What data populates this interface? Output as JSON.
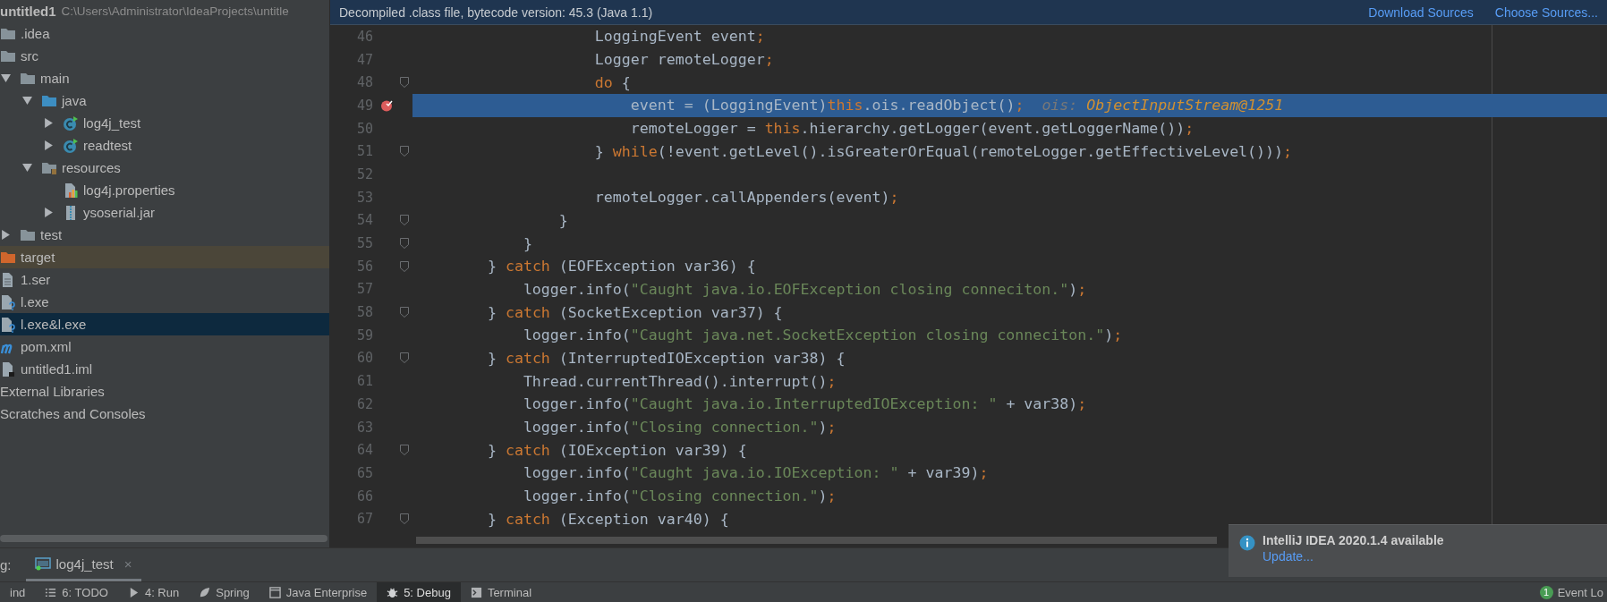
{
  "project_tree": [
    {
      "label": "untitled1",
      "kind": "project",
      "path": "C:\\Users\\Administrator\\IdeaProjects\\untitle",
      "selected": false,
      "children": [
        {
          "label": ".idea",
          "kind": "folder",
          "selected": false
        },
        {
          "label": "src",
          "kind": "folder",
          "selected": false,
          "children": [
            {
              "label": "main",
              "kind": "folder",
              "expanded": true,
              "selected": false,
              "children": [
                {
                  "label": "java",
                  "kind": "source-folder",
                  "expanded": true,
                  "selected": false,
                  "children": [
                    {
                      "label": "log4j_test",
                      "kind": "class",
                      "expanded": false,
                      "selected": false
                    },
                    {
                      "label": "readtest",
                      "kind": "class",
                      "expanded": false,
                      "selected": false
                    }
                  ]
                },
                {
                  "label": "resources",
                  "kind": "resources-folder",
                  "expanded": true,
                  "selected": false,
                  "children": [
                    {
                      "label": "log4j.properties",
                      "kind": "properties",
                      "selected": false
                    },
                    {
                      "label": "ysoserial.jar",
                      "kind": "jar",
                      "expanded": false,
                      "selected": false
                    }
                  ]
                }
              ]
            },
            {
              "label": "test",
              "kind": "folder",
              "expanded": false,
              "selected": false
            }
          ]
        },
        {
          "label": "target",
          "kind": "excluded-folder",
          "selected": false
        },
        {
          "label": "1.ser",
          "kind": "file",
          "selected": false
        },
        {
          "label": "l.exe",
          "kind": "unknown-file",
          "selected": false
        },
        {
          "label": "l.exe&l.exe",
          "kind": "unknown-file",
          "selected": true
        },
        {
          "label": "pom.xml",
          "kind": "maven",
          "selected": false
        },
        {
          "label": "untitled1.iml",
          "kind": "iml",
          "selected": false
        }
      ]
    },
    {
      "label": "External Libraries",
      "kind": "libraries",
      "selected": false
    },
    {
      "label": "Scratches and Consoles",
      "kind": "scratches",
      "selected": false
    }
  ],
  "editor": {
    "banner": "Decompiled .class file, bytecode version: 45.3 (Java 1.1)",
    "banner_links": [
      "Download Sources",
      "Choose Sources..."
    ],
    "lines": [
      {
        "number": "46",
        "tokens": [
          {
            "text": "                    LoggingEvent event",
            "kind": "plain"
          },
          {
            "text": ";",
            "kind": "keyword"
          }
        ]
      },
      {
        "number": "47",
        "tokens": [
          {
            "text": "                    Logger remoteLogger",
            "kind": "plain"
          },
          {
            "text": ";",
            "kind": "keyword"
          }
        ]
      },
      {
        "number": "48",
        "fold": true,
        "tokens": [
          {
            "text": "                    do",
            "kind": "keyword"
          },
          {
            "text": " {",
            "kind": "plain"
          }
        ]
      },
      {
        "number": "49",
        "breakpoint": true,
        "current": true,
        "tokens": [
          {
            "text": "                        event = (LoggingEvent)",
            "kind": "plain"
          },
          {
            "text": "this",
            "kind": "keyword"
          },
          {
            "text": ".ois.readObject()",
            "kind": "plain"
          },
          {
            "text": ";",
            "kind": "keyword"
          }
        ],
        "hint": {
          "name": "ois:",
          "value": "ObjectInputStream@1251"
        }
      },
      {
        "number": "50",
        "tokens": [
          {
            "text": "                        remoteLogger = ",
            "kind": "plain"
          },
          {
            "text": "this",
            "kind": "keyword"
          },
          {
            "text": ".hierarchy.getLogger(event.getLoggerName())",
            "kind": "plain"
          },
          {
            "text": ";",
            "kind": "keyword"
          }
        ]
      },
      {
        "number": "51",
        "fold": true,
        "tokens": [
          {
            "text": "                    } ",
            "kind": "plain"
          },
          {
            "text": "while",
            "kind": "keyword"
          },
          {
            "text": "(!event.getLevel().isGreaterOrEqual(remoteLogger.getEffectiveLevel()))",
            "kind": "plain"
          },
          {
            "text": ";",
            "kind": "keyword"
          }
        ]
      },
      {
        "number": "52"
      },
      {
        "number": "53",
        "tokens": [
          {
            "text": "                    remoteLogger.callAppenders(event)",
            "kind": "plain"
          },
          {
            "text": ";",
            "kind": "keyword"
          }
        ]
      },
      {
        "number": "54",
        "fold": true,
        "tokens": [
          {
            "text": "                }",
            "kind": "plain"
          }
        ]
      },
      {
        "number": "55",
        "fold": true,
        "tokens": [
          {
            "text": "            }",
            "kind": "plain"
          }
        ]
      },
      {
        "number": "56",
        "fold": true,
        "tokens": [
          {
            "text": "        } ",
            "kind": "plain"
          },
          {
            "text": "catch",
            "kind": "keyword"
          },
          {
            "text": " (EOFException var36) {",
            "kind": "plain"
          }
        ]
      },
      {
        "number": "57",
        "tokens": [
          {
            "text": "            logger.info(",
            "kind": "plain"
          },
          {
            "text": "\"Caught java.io.EOFException closing conneciton.\"",
            "kind": "string"
          },
          {
            "text": ")",
            "kind": "plain"
          },
          {
            "text": ";",
            "kind": "keyword"
          }
        ]
      },
      {
        "number": "58",
        "fold": true,
        "tokens": [
          {
            "text": "        } ",
            "kind": "plain"
          },
          {
            "text": "catch",
            "kind": "keyword"
          },
          {
            "text": " (SocketException var37) {",
            "kind": "plain"
          }
        ]
      },
      {
        "number": "59",
        "tokens": [
          {
            "text": "            logger.info(",
            "kind": "plain"
          },
          {
            "text": "\"Caught java.net.SocketException closing conneciton.\"",
            "kind": "string"
          },
          {
            "text": ")",
            "kind": "plain"
          },
          {
            "text": ";",
            "kind": "keyword"
          }
        ]
      },
      {
        "number": "60",
        "fold": true,
        "tokens": [
          {
            "text": "        } ",
            "kind": "plain"
          },
          {
            "text": "catch",
            "kind": "keyword"
          },
          {
            "text": " (InterruptedIOException var38) {",
            "kind": "plain"
          }
        ]
      },
      {
        "number": "61",
        "tokens": [
          {
            "text": "            Thread.currentThread().interrupt()",
            "kind": "plain"
          },
          {
            "text": ";",
            "kind": "keyword"
          }
        ]
      },
      {
        "number": "62",
        "tokens": [
          {
            "text": "            logger.info(",
            "kind": "plain"
          },
          {
            "text": "\"Caught java.io.InterruptedIOException: \"",
            "kind": "string"
          },
          {
            "text": " + var38)",
            "kind": "plain"
          },
          {
            "text": ";",
            "kind": "keyword"
          }
        ]
      },
      {
        "number": "63",
        "tokens": [
          {
            "text": "            logger.info(",
            "kind": "plain"
          },
          {
            "text": "\"Closing connection.\"",
            "kind": "string"
          },
          {
            "text": ")",
            "kind": "plain"
          },
          {
            "text": ";",
            "kind": "keyword"
          }
        ]
      },
      {
        "number": "64",
        "fold": true,
        "tokens": [
          {
            "text": "        } ",
            "kind": "plain"
          },
          {
            "text": "catch",
            "kind": "keyword"
          },
          {
            "text": " (IOException var39) {",
            "kind": "plain"
          }
        ]
      },
      {
        "number": "65",
        "tokens": [
          {
            "text": "            logger.info(",
            "kind": "plain"
          },
          {
            "text": "\"Caught java.io.IOException: \"",
            "kind": "string"
          },
          {
            "text": " + var39)",
            "kind": "plain"
          },
          {
            "text": ";",
            "kind": "keyword"
          }
        ]
      },
      {
        "number": "66",
        "tokens": [
          {
            "text": "            logger.info(",
            "kind": "plain"
          },
          {
            "text": "\"Closing connection.\"",
            "kind": "string"
          },
          {
            "text": ")",
            "kind": "plain"
          },
          {
            "text": ";",
            "kind": "keyword"
          }
        ]
      },
      {
        "number": "67",
        "fold": true,
        "tokens": [
          {
            "text": "        } ",
            "kind": "plain"
          },
          {
            "text": "catch",
            "kind": "keyword"
          },
          {
            "text": " (Exception var40) {",
            "kind": "plain"
          }
        ]
      }
    ]
  },
  "debug_panel": {
    "label": "g:",
    "tabs": [
      {
        "label": "log4j_test",
        "close": "×",
        "selected": true
      }
    ]
  },
  "tool_buttons": [
    {
      "label": "ind",
      "kind": "find",
      "selected": false
    },
    {
      "label": "6: TODO",
      "kind": "todo",
      "selected": false
    },
    {
      "label": "4: Run",
      "kind": "run",
      "selected": false
    },
    {
      "label": "Spring",
      "kind": "spring",
      "selected": false
    },
    {
      "label": "Java Enterprise",
      "kind": "enterprise",
      "selected": false
    },
    {
      "label": "5: Debug",
      "kind": "debug",
      "selected": true
    },
    {
      "label": "Terminal",
      "kind": "terminal",
      "selected": false
    }
  ],
  "event_log": {
    "badge": "1",
    "label": "Event Lo"
  },
  "notification": {
    "title": "IntelliJ IDEA 2020.1.4 available",
    "link": "Update..."
  }
}
